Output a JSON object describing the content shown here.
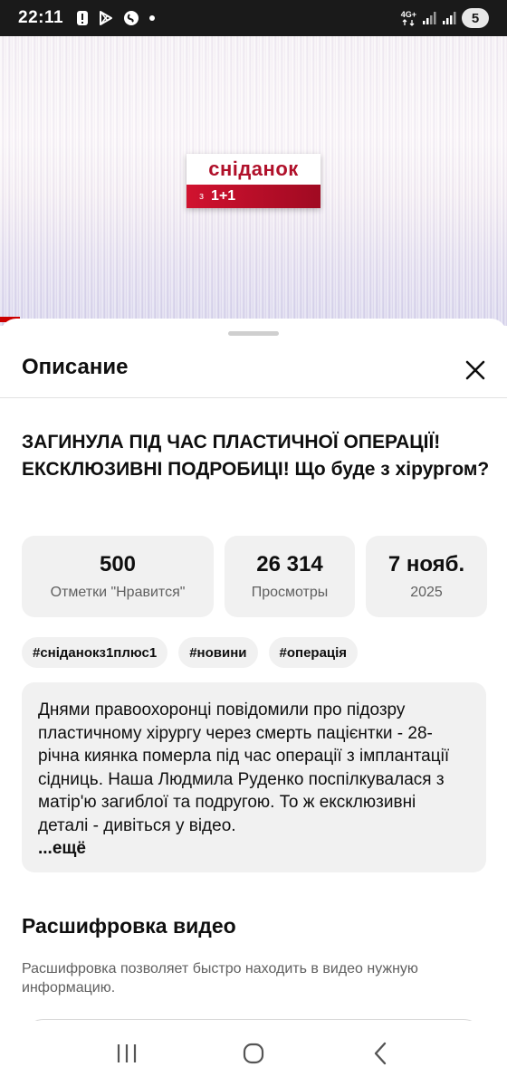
{
  "status_bar": {
    "time": "22:11",
    "network_label": "4G+",
    "battery": "5",
    "icons": [
      "alert-icon",
      "play-store-icon",
      "shazam-icon",
      "dot-icon",
      "network-4g-icon",
      "signal-icon",
      "signal-icon",
      "battery-icon"
    ]
  },
  "video": {
    "logo_text": "сніданок",
    "logo_sub_z": "з",
    "logo_sub_channel": "1+1"
  },
  "sheet": {
    "title": "Описание",
    "close_icon": "close-icon"
  },
  "video_title": "ЗАГИНУЛА ПІД ЧАС ПЛАСТИЧНОЇ ОПЕРАЦІЇ! ЕКСКЛЮЗИВНІ ПОДРОБИЦІ! Що буде з хірургом?",
  "stats": [
    {
      "value": "500",
      "label": "Отметки \"Нравится\""
    },
    {
      "value": "26 314",
      "label": "Просмотры"
    },
    {
      "value": "7 нояб.",
      "label": "2025"
    }
  ],
  "tags": [
    "#сніданокз1плюс1",
    "#новини",
    "#операція"
  ],
  "description": {
    "text": "Днями правоохоронці повідомили про підозру пластичному хірургу через смерть пацієнтки - 28-річна киянка померла під час операції з імплантації сідниць. Наша Людмила Руденко поспілкувалася з матір'ю загиблої та подругою. То ж ексклюзивні деталі - дивіться у відео.",
    "more": "...ещё"
  },
  "transcript": {
    "title": "Расшифровка видео",
    "description": "Расшифровка позволяет быстро находить в видео нужную информацию."
  },
  "nav_bar": {
    "icons": [
      "recent-apps-icon",
      "home-icon",
      "back-icon"
    ]
  },
  "colors": {
    "accent_red": "#cc0000",
    "logo_red": "#d1122f",
    "chip_bg": "#f1f1f1",
    "secondary_text": "#606060"
  }
}
